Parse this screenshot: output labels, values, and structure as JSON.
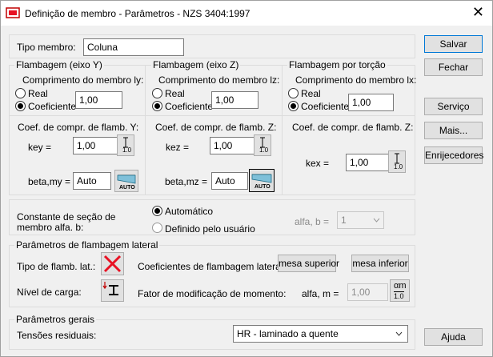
{
  "window": {
    "title": "Definição de membro - Parâmetros - NZS 3404:1997",
    "close_glyph": "✕"
  },
  "member_type": {
    "label": "Tipo membro:",
    "value": "Coluna"
  },
  "buckling_y": {
    "group_title": "Flambagem (eixo Y)",
    "length_label": "Comprimento do membro ly:",
    "real_label": "Real",
    "coef_label": "Coeficiente",
    "coef_value": "1,00",
    "coef_header": "Coef. de compr. de flamb. Y:",
    "key_label": "key =",
    "key_value": "1,00",
    "beta_label": "beta,my =",
    "beta_value": "Auto",
    "icon_value": "1.0",
    "auto_text": "AUTO"
  },
  "buckling_z": {
    "group_title": "Flambagem (eixo Z)",
    "length_label": "Comprimento do membro lz:",
    "real_label": "Real",
    "coef_label": "Coeficiente",
    "coef_value": "1,00",
    "coef_header": "Coef. de compr. de flamb. Z:",
    "kez_label": "kez =",
    "kez_value": "1,00",
    "beta_label": "beta,mz =",
    "beta_value": "Auto",
    "icon_value": "1.0",
    "auto_text": "AUTO"
  },
  "torsion": {
    "group_title": "Flambagem por torção",
    "length_label": "Comprimento do membro lx:",
    "real_label": "Real",
    "coef_label": "Coeficiente",
    "coef_value": "1,00",
    "coef_header": "Coef. de compr. de flamb. Z:",
    "kex_label": "kex =",
    "kex_value": "1,00",
    "icon_value": "1.0"
  },
  "section_constant": {
    "label": "Constante de seção de membro alfa. b:",
    "auto_label": "Automático",
    "user_label": "Definido pelo usuário",
    "alfa_label": "alfa, b =",
    "alfa_value": "1"
  },
  "lateral": {
    "group_title": "Parâmetros de flambagem lateral",
    "type_label": "Tipo de flamb. lat.:",
    "coef_label": "Coeficientes de flambagem lateral:",
    "upper_button": "mesa superior",
    "lower_button": "mesa inferior",
    "load_label": "Nível de carga:",
    "moment_label": "Fator de modificação de momento:",
    "alfa_m_label": "alfa, m =",
    "alfa_m_value": "1,00",
    "alfa_m_icon_top": "αm",
    "alfa_m_icon_bottom": "1.0"
  },
  "general": {
    "group_title": "Parâmetros gerais",
    "residual_label": "Tensões residuais:",
    "residual_value": "HR - laminado a quente"
  },
  "buttons": {
    "save": "Salvar",
    "close": "Fechar",
    "service": "Serviço",
    "more": "Mais...",
    "stiffeners": "Enrijecedores",
    "help": "Ajuda"
  },
  "colors": {
    "accent": "#0078d7",
    "red_x": "#e81123"
  }
}
